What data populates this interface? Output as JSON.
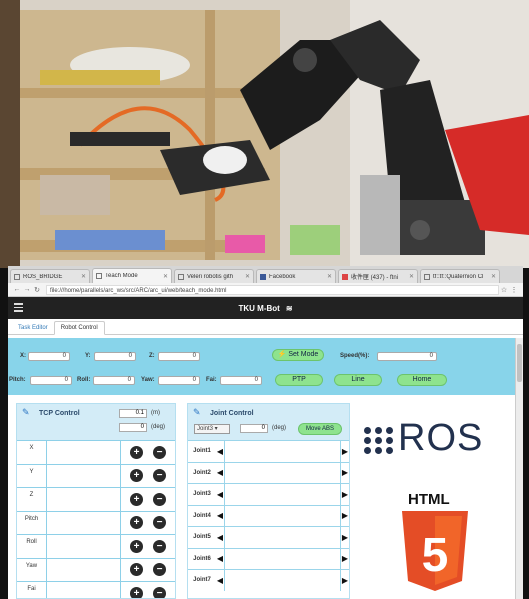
{
  "browser": {
    "tabs": [
      {
        "label": "ROS_BRIDGE",
        "icon": "page-icon",
        "active": false
      },
      {
        "label": "Teach Mode",
        "icon": "page-icon",
        "active": true
      },
      {
        "label": "Veleri robotis gith",
        "icon": "page-icon",
        "active": false
      },
      {
        "label": "Facebook",
        "icon": "facebook-icon",
        "active": false
      },
      {
        "label": "收件匣 (437) - ftni",
        "icon": "gmail-icon",
        "active": false
      },
      {
        "label": "tf::tf::Quaternion Cl",
        "icon": "page-icon",
        "active": false
      }
    ],
    "url": "file:///home/parallels/arc_ws/src/ARC/arc_ui/web/teach_mode.html"
  },
  "app": {
    "title": "TKU M-Bot",
    "tabs": [
      {
        "label": "Task Editor",
        "active": false
      },
      {
        "label": "Robot Control",
        "active": true
      }
    ]
  },
  "position": {
    "x_label": "X:",
    "x_value": "0",
    "y_label": "Y:",
    "y_value": "0",
    "z_label": "Z:",
    "z_value": "0",
    "pitch_label": "Pitch:",
    "pitch_value": "0",
    "roll_label": "Roll:",
    "roll_value": "0",
    "yaw_label": "Yaw:",
    "yaw_value": "0",
    "fai_label": "Fai:",
    "fai_value": "0",
    "set_mode_label": "⚡ Set Mode",
    "speed_label": "Speed(%):",
    "speed_value": "0",
    "ptp_label": "PTP",
    "line_label": "Line",
    "home_label": "Home"
  },
  "tcp": {
    "title": "TCP Control",
    "step_m_value": "0.1",
    "step_m_unit": "(m)",
    "step_deg_value": "0",
    "step_deg_unit": "(deg)",
    "rows": [
      "X",
      "Y",
      "Z",
      "Pitch",
      "Roll",
      "Yaw",
      "Fai"
    ],
    "plus_symbol": "+",
    "minus_symbol": "−"
  },
  "joint": {
    "title": "Joint Control",
    "selected_joint": "Joint3 ▾",
    "deg_value": "0",
    "deg_unit": "(deg)",
    "move_abs_label": "Move ABS",
    "rows": [
      "Joint1",
      "Joint2",
      "Joint3",
      "Joint4",
      "Joint5",
      "Joint6",
      "Joint7"
    ],
    "left_arrow": "◀",
    "right_arrow": "▶"
  },
  "logos": {
    "ros_text": "ROS",
    "html_text": "HTML",
    "html5_digit": "5"
  },
  "colors": {
    "panel": "#88d4ea",
    "green_button": "#8ee38e",
    "navbar": "#222222",
    "ros": "#22314e",
    "html5_orange": "#e44d26"
  }
}
